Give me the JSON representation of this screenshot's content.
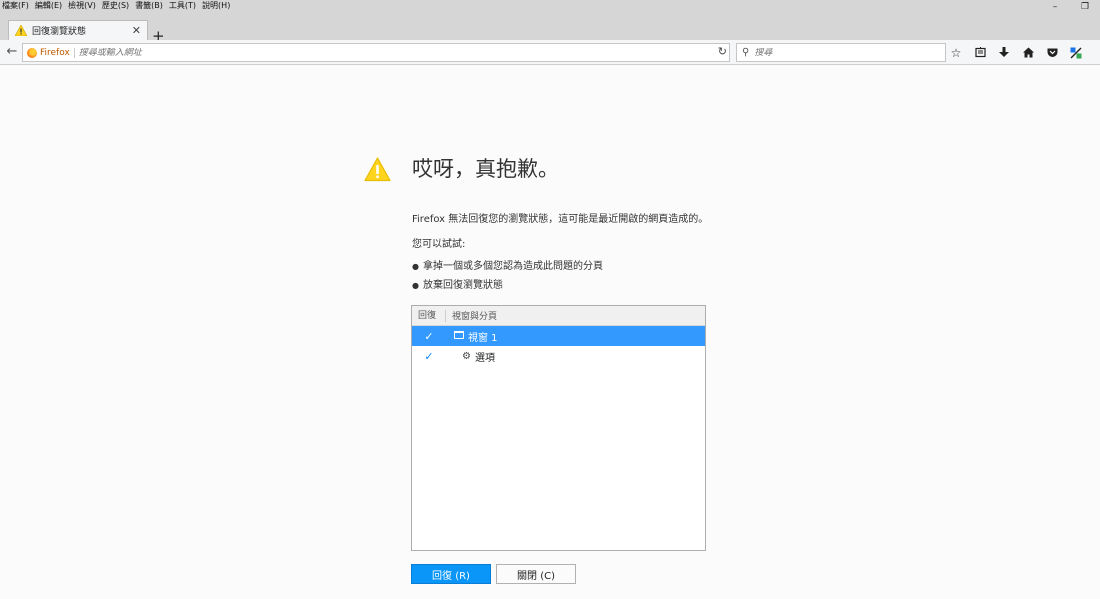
{
  "menubar": {
    "items": [
      "檔案(F)",
      "編輯(E)",
      "檢視(V)",
      "歷史(S)",
      "書籤(B)",
      "工具(T)",
      "說明(H)"
    ]
  },
  "window_controls": {
    "minimize": "–",
    "restore": "❐"
  },
  "tab": {
    "title": "回復瀏覽狀態",
    "close": "✕",
    "new_tab": "+"
  },
  "navbar": {
    "brand": "Firefox",
    "url_placeholder": "搜尋或輸入網址",
    "search_placeholder": "搜尋",
    "reload": "↻"
  },
  "content": {
    "title": "哎呀，真抱歉。",
    "description": "Firefox 無法回復您的瀏覽狀態，這可能是最近開啟的網頁造成的。",
    "try_label": "您可以試試:",
    "suggestions": [
      "拿掉一個或多個您認為造成此問題的分頁",
      "放棄回復瀏覽狀態"
    ]
  },
  "tree": {
    "col_restore": "回復",
    "col_name": "視窗與分頁",
    "rows": [
      {
        "check": "✓",
        "label": "視窗 1"
      },
      {
        "check": "✓",
        "label": "選項"
      }
    ]
  },
  "buttons": {
    "restore": "回復 (R)",
    "close": "關閉 (C)"
  },
  "colors": {
    "accent": "#0996f8",
    "selected_row": "#3399ff",
    "warning": "#ffd41e"
  }
}
